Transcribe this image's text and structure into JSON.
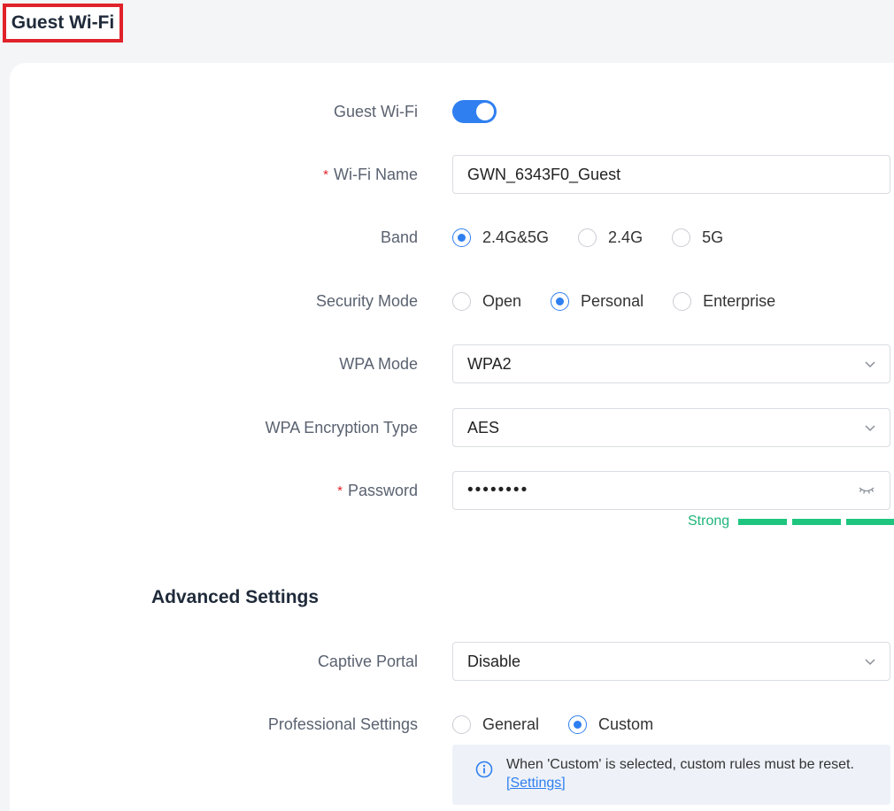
{
  "page_title": "Guest Wi-Fi",
  "form": {
    "guest_wifi": {
      "label": "Guest Wi-Fi",
      "enabled": true
    },
    "wifi_name": {
      "label": "Wi-Fi Name",
      "required_mark": "*",
      "value": "GWN_6343F0_Guest"
    },
    "band": {
      "label": "Band",
      "options": [
        "2.4G&5G",
        "2.4G",
        "5G"
      ],
      "selected": "2.4G&5G"
    },
    "security_mode": {
      "label": "Security Mode",
      "options": [
        "Open",
        "Personal",
        "Enterprise"
      ],
      "selected": "Personal"
    },
    "wpa_mode": {
      "label": "WPA Mode",
      "value": "WPA2"
    },
    "wpa_encryption": {
      "label": "WPA Encryption Type",
      "value": "AES"
    },
    "password": {
      "label": "Password",
      "required_mark": "*",
      "value": "••••••••",
      "strength_label": "Strong",
      "strength_level": "3/3"
    }
  },
  "advanced": {
    "title": "Advanced Settings",
    "captive_portal": {
      "label": "Captive Portal",
      "value": "Disable"
    },
    "professional_settings": {
      "label": "Professional Settings",
      "options": [
        "General",
        "Custom"
      ],
      "selected": "Custom"
    },
    "info": {
      "message": "When 'Custom' is selected, custom rules must be reset.",
      "link": "[Settings]"
    }
  },
  "colors": {
    "accent": "#2f7ff0",
    "required": "#e0222a",
    "strong": "#1ec57f",
    "highlight_border": "#e0222a"
  },
  "icons": {
    "select": "chevron-down-icon",
    "password_toggle": "eye-closed-icon",
    "info": "info-icon"
  }
}
